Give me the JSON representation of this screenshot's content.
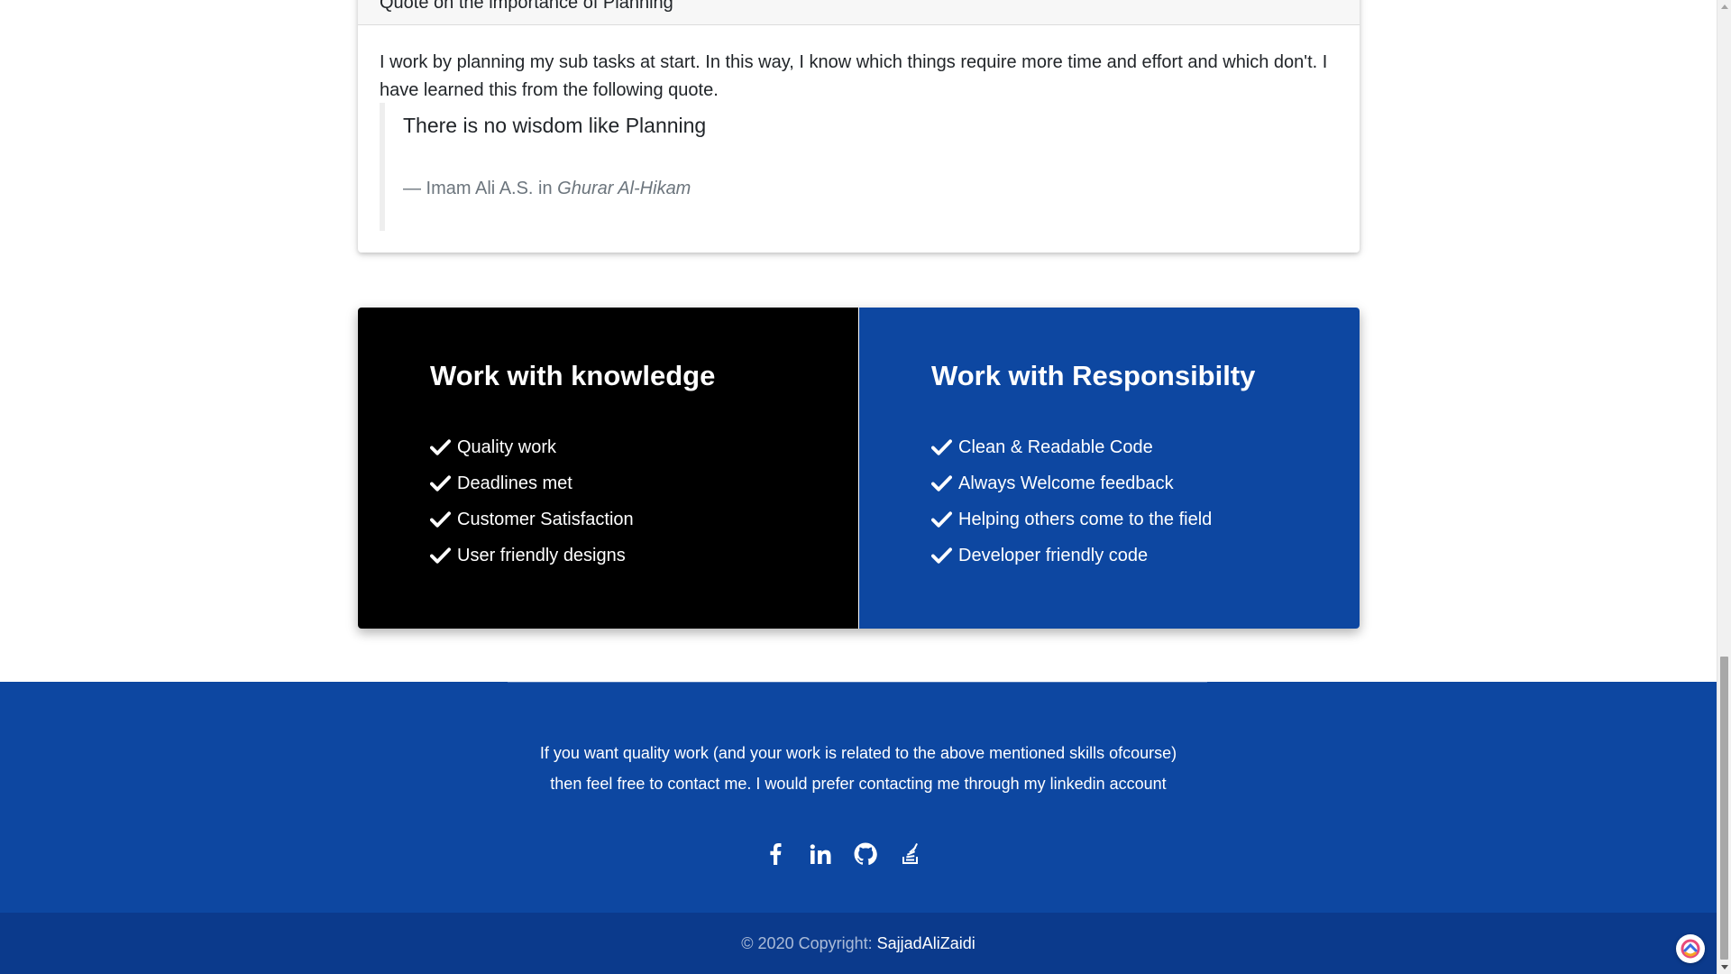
{
  "quote_card": {
    "header": "Quote on the importance of Planning",
    "text": "I work by planning my sub tasks at start. In this way, I know which things require more time and effort and which don't. I have learned this from the following quote.",
    "quote": "There is no wisdom like Planning",
    "footer_prefix": "— Imam Ali A.S. in",
    "source": "Ghurar Al-Hikam"
  },
  "features": {
    "left": {
      "title": "Work with knowledge",
      "items": [
        "Quality work",
        "Deadlines met",
        "Customer Satisfaction",
        "User friendly designs"
      ]
    },
    "right": {
      "title": "Work with Responsibilty",
      "items": [
        "Clean & Readable Code",
        "Always Welcome feedback",
        "Helping others come to the field",
        "Developer friendly code"
      ]
    }
  },
  "footer": {
    "line1": "If you want quality work (and your work is related to the above mentioned skills ofcourse)",
    "line2": "then feel free to contact me. I would prefer contacting me through my linkedin account",
    "social_icons": [
      "facebook-icon",
      "linkedin-icon",
      "github-icon",
      "stackoverflow-icon"
    ]
  },
  "copyright": {
    "prefix": "© 2020 Copyright:",
    "name": "SajjadAliZaidi"
  },
  "colors": {
    "primary_blue": "#0d47a1",
    "dark_footer": "#0b3a8c",
    "black_panel": "#000000"
  }
}
